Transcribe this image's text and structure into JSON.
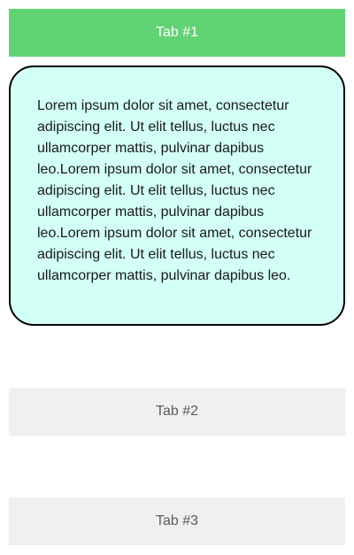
{
  "tabs": [
    {
      "label": "Tab #1",
      "active": true,
      "content": "Lorem ipsum dolor sit amet, consectetur adipiscing elit. Ut elit tellus, luctus nec ullamcorper mattis, pulvinar dapibus leo.Lorem ipsum dolor sit amet, consectetur adipiscing elit. Ut elit tellus, luctus nec ullamcorper mattis, pulvinar dapibus leo.Lorem ipsum dolor sit amet, consectetur adipiscing elit. Ut elit tellus, luctus nec ullamcorper mattis, pulvinar dapibus leo."
    },
    {
      "label": "Tab #2",
      "active": false
    },
    {
      "label": "Tab #3",
      "active": false
    }
  ],
  "colors": {
    "active_tab": "#61d375",
    "inactive_tab": "#eff0f1",
    "panel_background": "#d2fff6",
    "panel_border": "#000000"
  }
}
